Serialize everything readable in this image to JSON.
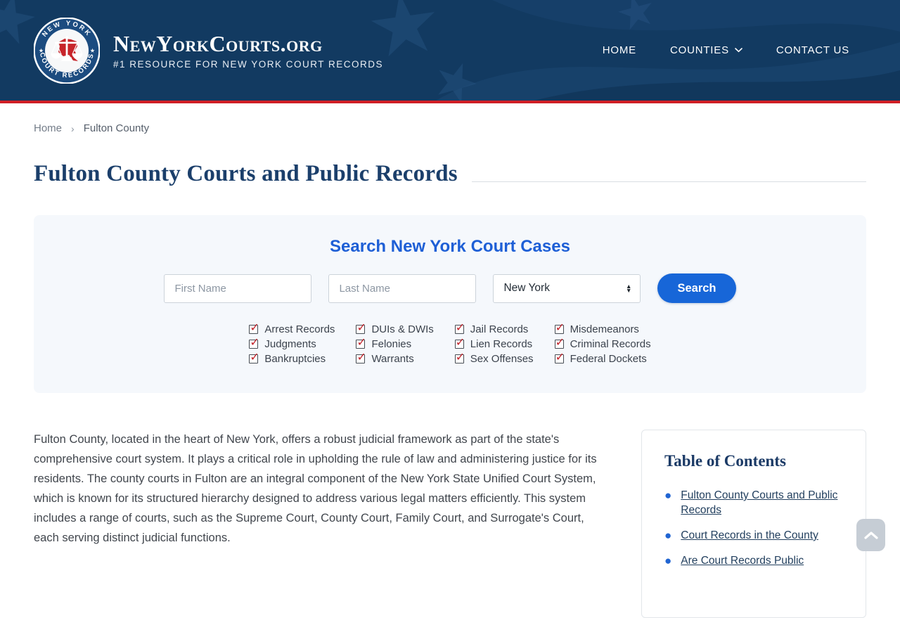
{
  "header": {
    "logo": {
      "title": "NewYorkCourts.org",
      "tagline": "#1 RESOURCE FOR NEW YORK COURT RECORDS",
      "seal_top": "NEW YORK",
      "seal_bottom": "COURT RECORDS"
    },
    "nav": [
      {
        "label": "HOME"
      },
      {
        "label": "COUNTIES",
        "has_dropdown": true
      },
      {
        "label": "CONTACT US"
      }
    ]
  },
  "breadcrumb": {
    "items": [
      "Home",
      "Fulton County"
    ],
    "separator": "›"
  },
  "page": {
    "title": "Fulton County Courts and Public Records"
  },
  "search": {
    "heading": "Search New York Court Cases",
    "first_name_placeholder": "First Name",
    "last_name_placeholder": "Last Name",
    "state_selected": "New York",
    "button_label": "Search",
    "checkbox_columns": [
      [
        "Arrest Records",
        "Judgments",
        "Bankruptcies"
      ],
      [
        "DUIs & DWIs",
        "Felonies",
        "Warrants"
      ],
      [
        "Jail Records",
        "Lien Records",
        "Sex Offenses"
      ],
      [
        "Misdemeanors",
        "Criminal Records",
        "Federal Dockets"
      ]
    ],
    "all_checked": true
  },
  "article": {
    "paragraph": "Fulton County, located in the heart of New York, offers a robust judicial framework as part of the state's comprehensive court system. It plays a critical role in upholding the rule of law and administering justice for its residents. The county courts in Fulton are an integral component of the New York State Unified Court System, which is known for its structured hierarchy designed to address various legal matters efficiently. This system includes a range of courts, such as the Supreme Court, County Court, Family Court, and Surrogate's Court, each serving distinct judicial functions."
  },
  "toc": {
    "heading": "Table of Contents",
    "links": [
      "Fulton County Courts and Public Records",
      "Court Records in the County",
      "Are Court Records Public"
    ]
  },
  "icons": {
    "check": "✓",
    "caret_up": "▲",
    "caret_down": "▼"
  },
  "palette": {
    "header_navy": "#123a61",
    "accent_red": "#d01f26",
    "heading_blue": "#1e5fd6",
    "button_blue": "#1766d8",
    "check_red": "#c3232b",
    "link_navy": "#23405f",
    "panel_bg": "#f5f8fc"
  }
}
